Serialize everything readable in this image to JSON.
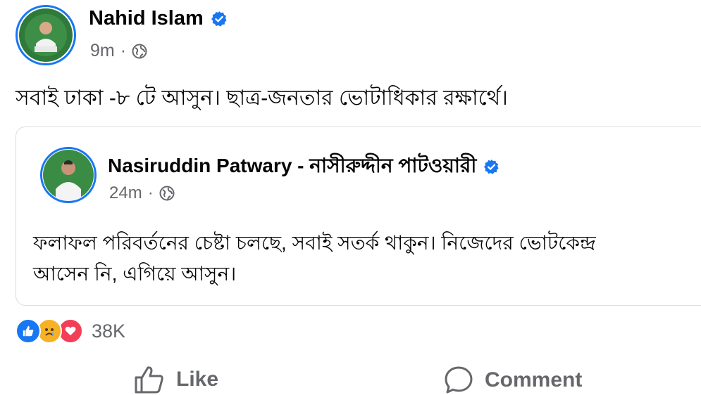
{
  "post": {
    "author": "Nahid Islam",
    "time": "9m",
    "privacy_icon": "globe-icon",
    "text": "সবাই ঢাকা -৮ টে আসুন। ছাত্র-জনতার ভোটাধিকার রক্ষার্থে।"
  },
  "shared_post": {
    "author": "Nasiruddin Patwary - নাসীরুদ্দীন পাটওয়ারী",
    "time": "24m",
    "privacy_icon": "globe-icon",
    "text_line1": "ফলাফল পরিবর্তনের চেষ্টা চলছে, সবাই সতর্ক থাকুন। নিজেদের ভোটকেন্দ্র",
    "text_line2": "আসেন নি, এগিয়ে আসুন।"
  },
  "reactions": {
    "icons": [
      "like-reaction-icon",
      "sad-reaction-icon",
      "love-reaction-icon"
    ],
    "count": "38K"
  },
  "actions": {
    "like_label": "Like",
    "comment_label": "Comment"
  },
  "colors": {
    "verified_blue": "#1877f2",
    "love_red": "#f33e58",
    "sad_yellow": "#f7b125",
    "secondary_text": "#65676b"
  }
}
